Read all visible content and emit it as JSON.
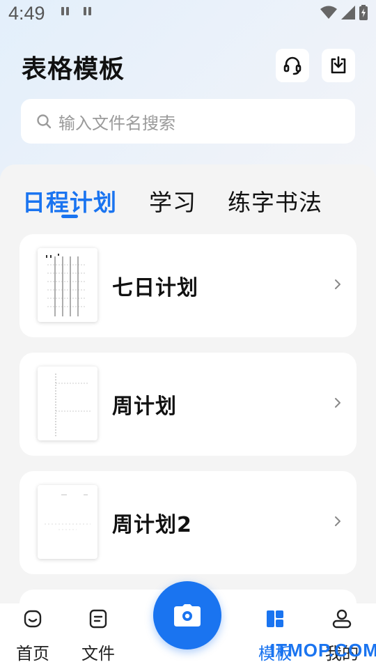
{
  "status_bar": {
    "time": "4:49"
  },
  "header": {
    "title": "表格模板"
  },
  "icons": {
    "support": "headset-icon",
    "download": "download-icon",
    "search": "search-icon",
    "chevron": "chevron-right-icon",
    "camera": "camera-icon"
  },
  "search": {
    "placeholder": "输入文件名搜索"
  },
  "tabs": [
    {
      "label": "日程计划",
      "active": true
    },
    {
      "label": "学习",
      "active": false
    },
    {
      "label": "练字书法",
      "active": false
    }
  ],
  "templates": [
    {
      "title": "七日计划"
    },
    {
      "title": "周计划"
    },
    {
      "title": "周计划2"
    }
  ],
  "bottom_nav": [
    {
      "label": "首页",
      "icon": "home-icon",
      "active": false
    },
    {
      "label": "文件",
      "icon": "file-icon",
      "active": false
    },
    {
      "label": "模板",
      "icon": "template-grid-icon",
      "active": true
    },
    {
      "label": "我的",
      "icon": "profile-icon",
      "active": false
    }
  ],
  "watermark": "ITMOP.COM",
  "colors": {
    "accent": "#1a74f0",
    "panel": "#f4f4f4",
    "card": "#ffffff"
  }
}
